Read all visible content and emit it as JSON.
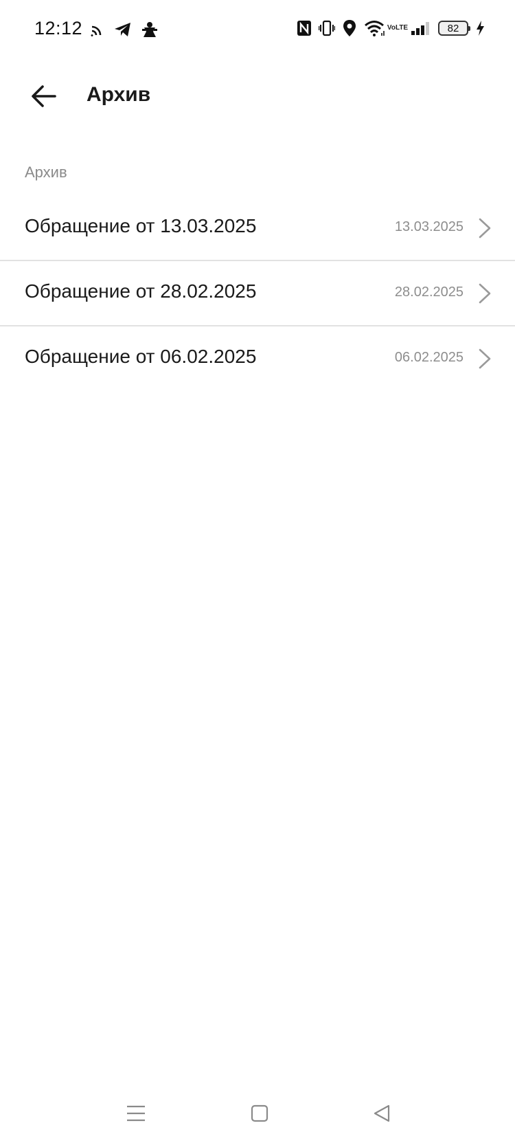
{
  "status_bar": {
    "time": "12:12",
    "battery_level": "82",
    "volte_line1": "Vo",
    "volte_line2": "LTE",
    "icons_left": [
      "cast-icon",
      "telegram-icon",
      "app-notification-icon"
    ],
    "icons_right": [
      "nfc-icon",
      "vibrate-icon",
      "location-icon",
      "wifi-icon",
      "volte-icon",
      "signal-icon",
      "battery-icon",
      "charging-icon"
    ]
  },
  "header": {
    "title": "Архив",
    "back_icon": "arrow-left-icon"
  },
  "section": {
    "label": "Архив"
  },
  "items": [
    {
      "title": "Обращение от 13.03.2025",
      "date": "13.03.2025"
    },
    {
      "title": "Обращение от 28.02.2025",
      "date": "28.02.2025"
    },
    {
      "title": "Обращение от 06.02.2025",
      "date": "06.02.2025"
    }
  ],
  "colors": {
    "text_primary": "#1a1a1a",
    "text_secondary": "#8a8a8a",
    "divider": "#e2e2e2",
    "chevron": "#9a9a9a",
    "nav_icon": "#8a8a8a"
  },
  "nav": {
    "icons": [
      "menu-icon",
      "home-icon",
      "back-triangle-icon"
    ]
  }
}
